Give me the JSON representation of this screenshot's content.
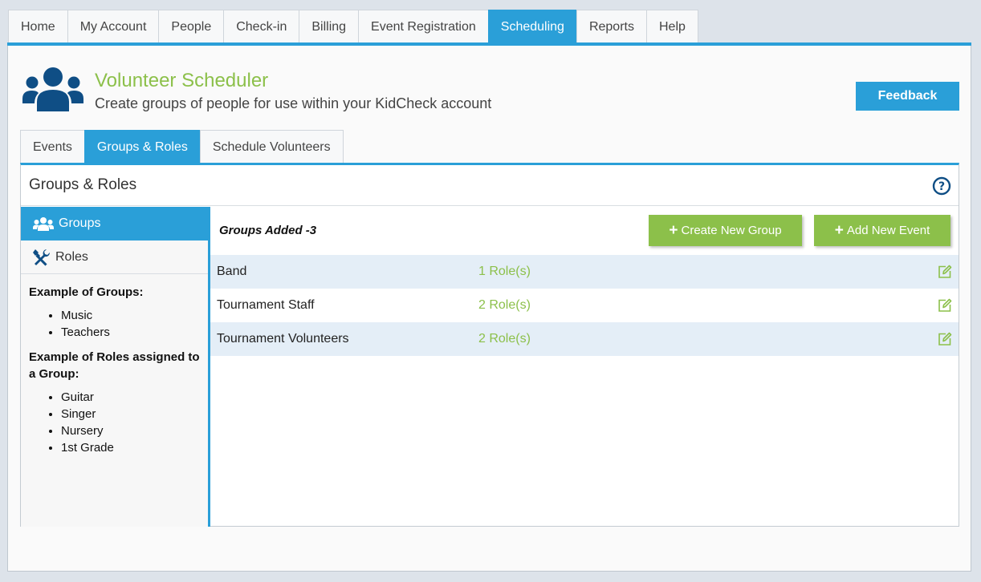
{
  "topnav": {
    "tabs": [
      {
        "label": "Home"
      },
      {
        "label": "My Account"
      },
      {
        "label": "People"
      },
      {
        "label": "Check-in"
      },
      {
        "label": "Billing"
      },
      {
        "label": "Event Registration"
      },
      {
        "label": "Scheduling"
      },
      {
        "label": "Reports"
      },
      {
        "label": "Help"
      }
    ],
    "active": "Scheduling"
  },
  "header": {
    "icon": "users-group-icon",
    "title": "Volunteer Scheduler",
    "subtitle": "Create groups of people for use within your KidCheck account",
    "feedback_label": "Feedback"
  },
  "subtabs": {
    "tabs": [
      {
        "label": "Events"
      },
      {
        "label": "Groups & Roles"
      },
      {
        "label": "Schedule Volunteers"
      }
    ],
    "active": "Groups & Roles"
  },
  "panel": {
    "title": "Groups & Roles",
    "help_icon": "question-circle-icon"
  },
  "sidebar": {
    "items": [
      {
        "label": "Groups",
        "icon": "users-icon"
      },
      {
        "label": "Roles",
        "icon": "tools-icon"
      }
    ],
    "groups_heading": "Example of Groups:",
    "groups_examples": [
      "Music",
      "Teachers"
    ],
    "roles_heading": "Example of Roles assigned to a Group:",
    "roles_examples": [
      "Guitar",
      "Singer",
      "Nursery",
      "1st Grade"
    ]
  },
  "main": {
    "count_label": "Groups Added -3",
    "create_group_label": "Create New Group",
    "add_event_label": "Add New Event",
    "groups": [
      {
        "name": "Band",
        "roles": "1 Role(s)"
      },
      {
        "name": "Tournament Staff",
        "roles": "2 Role(s)"
      },
      {
        "name": "Tournament Volunteers",
        "roles": "2 Role(s)"
      }
    ]
  },
  "colors": {
    "accent_blue": "#2a9fd8",
    "accent_green": "#8cc04a",
    "row_alt": "#e4eef7",
    "icon_navy": "#0f4e85"
  }
}
